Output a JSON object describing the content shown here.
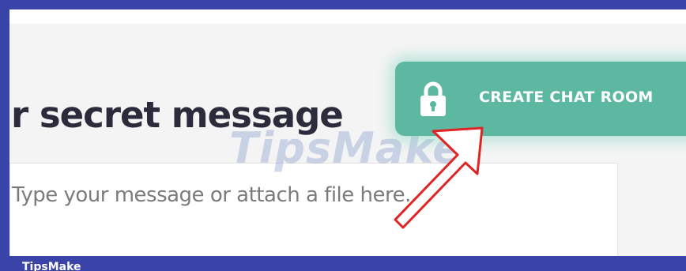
{
  "heading": {
    "text": "r secret message"
  },
  "message": {
    "placeholder": "Type your message or attach a file here..."
  },
  "create_button": {
    "label": "CREATE CHAT ROOM",
    "icon": "lock-icon"
  },
  "watermark": {
    "text": "TipsMake"
  },
  "footer": {
    "brand": "TipsMake"
  },
  "colors": {
    "frame": "#3a43a8",
    "button": "#5cb8a0",
    "heading": "#2b2b3c",
    "arrow": "#e02424"
  }
}
